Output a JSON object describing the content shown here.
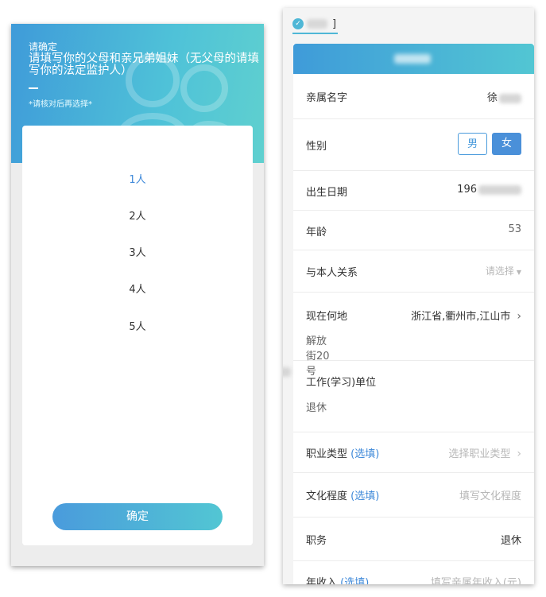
{
  "left": {
    "confirm_title": "请确定",
    "main_title": "请填写你的父母和亲兄弟姐妹（无父母的请填写你的法定监护人）",
    "hint": "*请核对后再选择*",
    "options": [
      "1人",
      "2人",
      "3人",
      "4人",
      "5人"
    ],
    "selected_option": "1人",
    "confirm_button": "确定"
  },
  "right": {
    "tab_label": "]",
    "rows": {
      "relative_name": {
        "label": "亲属名字",
        "value": "徐"
      },
      "gender": {
        "label": "性别",
        "male": "男",
        "female": "女",
        "selected": "女"
      },
      "birth_date": {
        "label": "出生日期",
        "value": "196"
      },
      "age": {
        "label": "年龄",
        "value": "53"
      },
      "relationship": {
        "label": "与本人关系",
        "placeholder": "请选择"
      },
      "location": {
        "label": "现在何地",
        "value": "浙江省,衢州市,江山市",
        "address_line": "解放街20号"
      },
      "work_unit": {
        "label": "工作(学习)单位",
        "value": "退休"
      },
      "occupation_type": {
        "label": "职业类型",
        "optional": "(选填)",
        "placeholder": "选择职业类型"
      },
      "education": {
        "label": "文化程度",
        "optional": "(选填)",
        "placeholder": "填写文化程度"
      },
      "position": {
        "label": "职务",
        "value": "退休"
      },
      "income": {
        "label": "年收入",
        "optional": "(选填)",
        "placeholder": "填写亲属年收入(元)"
      }
    }
  },
  "colors": {
    "header_gradient_start": "#3f9bd9",
    "header_gradient_end": "#5fd0cf",
    "accent_blue": "#3d88d9",
    "tab_accent": "#4fb7d6"
  }
}
